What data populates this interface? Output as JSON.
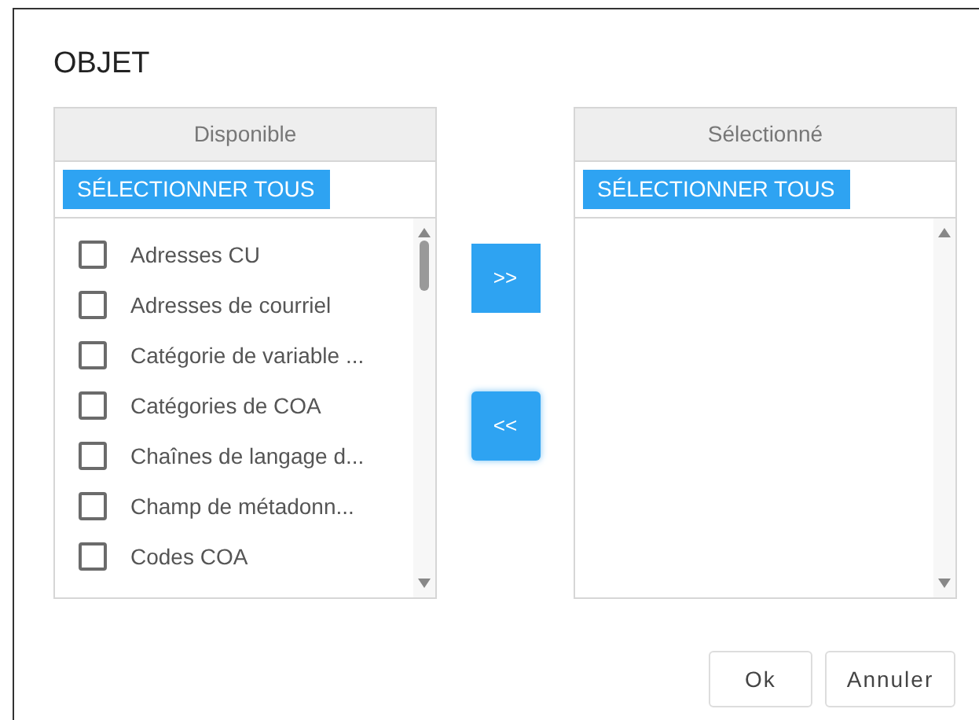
{
  "dialog": {
    "title": "OBJET"
  },
  "available": {
    "header": "Disponible",
    "select_all": "SÉLECTIONNER TOUS",
    "items": [
      {
        "label": "Adresses CU",
        "checked": false
      },
      {
        "label": "Adresses de courriel",
        "checked": false
      },
      {
        "label": "Catégorie de variable ...",
        "checked": false
      },
      {
        "label": "Catégories de COA",
        "checked": false
      },
      {
        "label": "Chaînes de langage d...",
        "checked": false
      },
      {
        "label": "Champ de métadonn...",
        "checked": false
      },
      {
        "label": "Codes COA",
        "checked": false
      }
    ]
  },
  "move_buttons": [
    ">>",
    "<<"
  ],
  "selected": {
    "header": "Sélectionné",
    "select_all": "SÉLECTIONNER TOUS"
  },
  "buttons": [
    "Ok",
    "Annuler"
  ]
}
